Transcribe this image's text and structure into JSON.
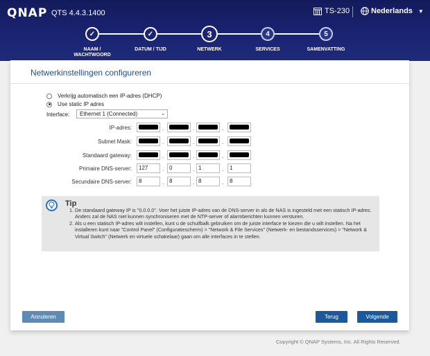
{
  "header": {
    "logo": "QNAP",
    "version": "QTS 4.4.3.1400",
    "device_icon": "server-icon",
    "device_name": "TS-230",
    "language_icon": "globe-icon",
    "language": "Nederlands"
  },
  "steps": [
    {
      "number": "✓",
      "label_line1": "NAAM /",
      "label_line2": "WACHTWOORD",
      "state": "done"
    },
    {
      "number": "✓",
      "label_line1": "DATUM / TIJD",
      "label_line2": "",
      "state": "done"
    },
    {
      "number": "3",
      "label_line1": "NETWERK",
      "label_line2": "",
      "state": "active"
    },
    {
      "number": "4",
      "label_line1": "SERVICES",
      "label_line2": "",
      "state": "todo"
    },
    {
      "number": "5",
      "label_line1": "SAMENVATTING",
      "label_line2": "",
      "state": "todo"
    }
  ],
  "panel": {
    "title": "Netwerkinstellingen configureren",
    "radio_dhcp": "Verkrijg automatisch een IP-adres (DHCP)",
    "radio_static": "Use static IP adres",
    "interface_label": "Interface:",
    "interface_value": "Ethernet 1 (Connected)",
    "fields": {
      "ip": {
        "label": "IP-adres:",
        "values": [
          "",
          "",
          "",
          ""
        ]
      },
      "mask": {
        "label": "Subnet Mask:",
        "values": [
          "",
          "",
          "",
          ""
        ]
      },
      "gateway": {
        "label": "Standaard gateway:",
        "values": [
          "",
          "",
          "",
          ""
        ]
      },
      "dns1": {
        "label": "Primaire DNS-server:",
        "values": [
          "127",
          "0",
          "1",
          "1"
        ]
      },
      "dns2": {
        "label": "Secundaire DNS-server:",
        "values": [
          "8",
          "8",
          "8",
          "8"
        ]
      }
    },
    "tip": {
      "title": "Tip",
      "items": [
        "De standaard gateway IP is \"0.0.0.0\". Voer het juiste IP-adres van de DNS-server in als de NAS is ingesteld met een statisch IP-adres. Anders zal de NAS niet kunnen synchroniseren met de NTP-server of alarmberichten kunnen versturen.",
        "Als u een statisch IP-adres wilt instellen, kunt u de schuifbalk gebruiken om de juiste interface te kiezen die u wilt instellen. Na het installeren kunt naar \"Control Panel\" (Configuratiescherm) > \"Network & File Services\" (Netwerk- en bestandsservices) > \"Network & Virtual Switch\" (Netwerk en virtuele schakelaar) gaan om alle interfaces in te stellen."
      ]
    },
    "buttons": {
      "cancel": "Annuleren",
      "back": "Terug",
      "next": "Volgende"
    }
  },
  "footer": {
    "copyright": "Copyright © QNAP Systems, Inc. All Rights Reserved."
  }
}
